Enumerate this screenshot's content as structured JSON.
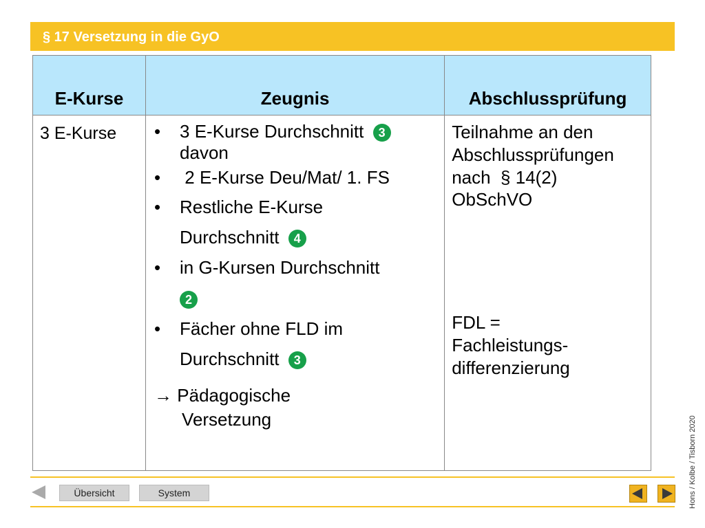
{
  "header": {
    "title": "§  17 Versetzung in die GyO"
  },
  "table": {
    "headers": [
      "E-Kurse",
      "Zeugnis",
      "Abschlussprüfung"
    ],
    "col1": "3 E-Kurse",
    "zeugnis_items": [
      {
        "bullet": "•",
        "line1": "3 E-Kurse Durchschnitt",
        "badge": "3",
        "line2": "davon"
      },
      {
        "bullet": "•",
        "line1": " 2 E-Kurse Deu/Mat/ 1. FS"
      },
      {
        "bullet": "•",
        "line1": "Restliche E-Kurse",
        "line2": "Durchschnitt",
        "badge": "4"
      },
      {
        "bullet": "•",
        "line1": "in G-Kursen Durchschnitt",
        "badge": "2"
      },
      {
        "bullet": "•",
        "line1": "Fächer ohne FLD im",
        "line2": "Durchschnitt",
        "badge": "3"
      }
    ],
    "arrow_symbol": "→",
    "arrow_line1": "Pädagogische",
    "arrow_line2": "Versetzung",
    "col3_text": [
      "Teilnahme an den",
      "Abschlussprüfungen",
      "nach  § 14(2)",
      "ObSchVO"
    ],
    "col3_note": [
      "FDL =",
      "Fachleistungs-",
      "differenzierung"
    ]
  },
  "nav": {
    "overview_label": "Übersicht",
    "system_label": "System"
  },
  "copyright": "Hons / Kolbe / Tisborn 2020",
  "colors": {
    "accent": "#f7c224",
    "header_bg": "#b9e7fc",
    "badge": "#17a04a"
  }
}
